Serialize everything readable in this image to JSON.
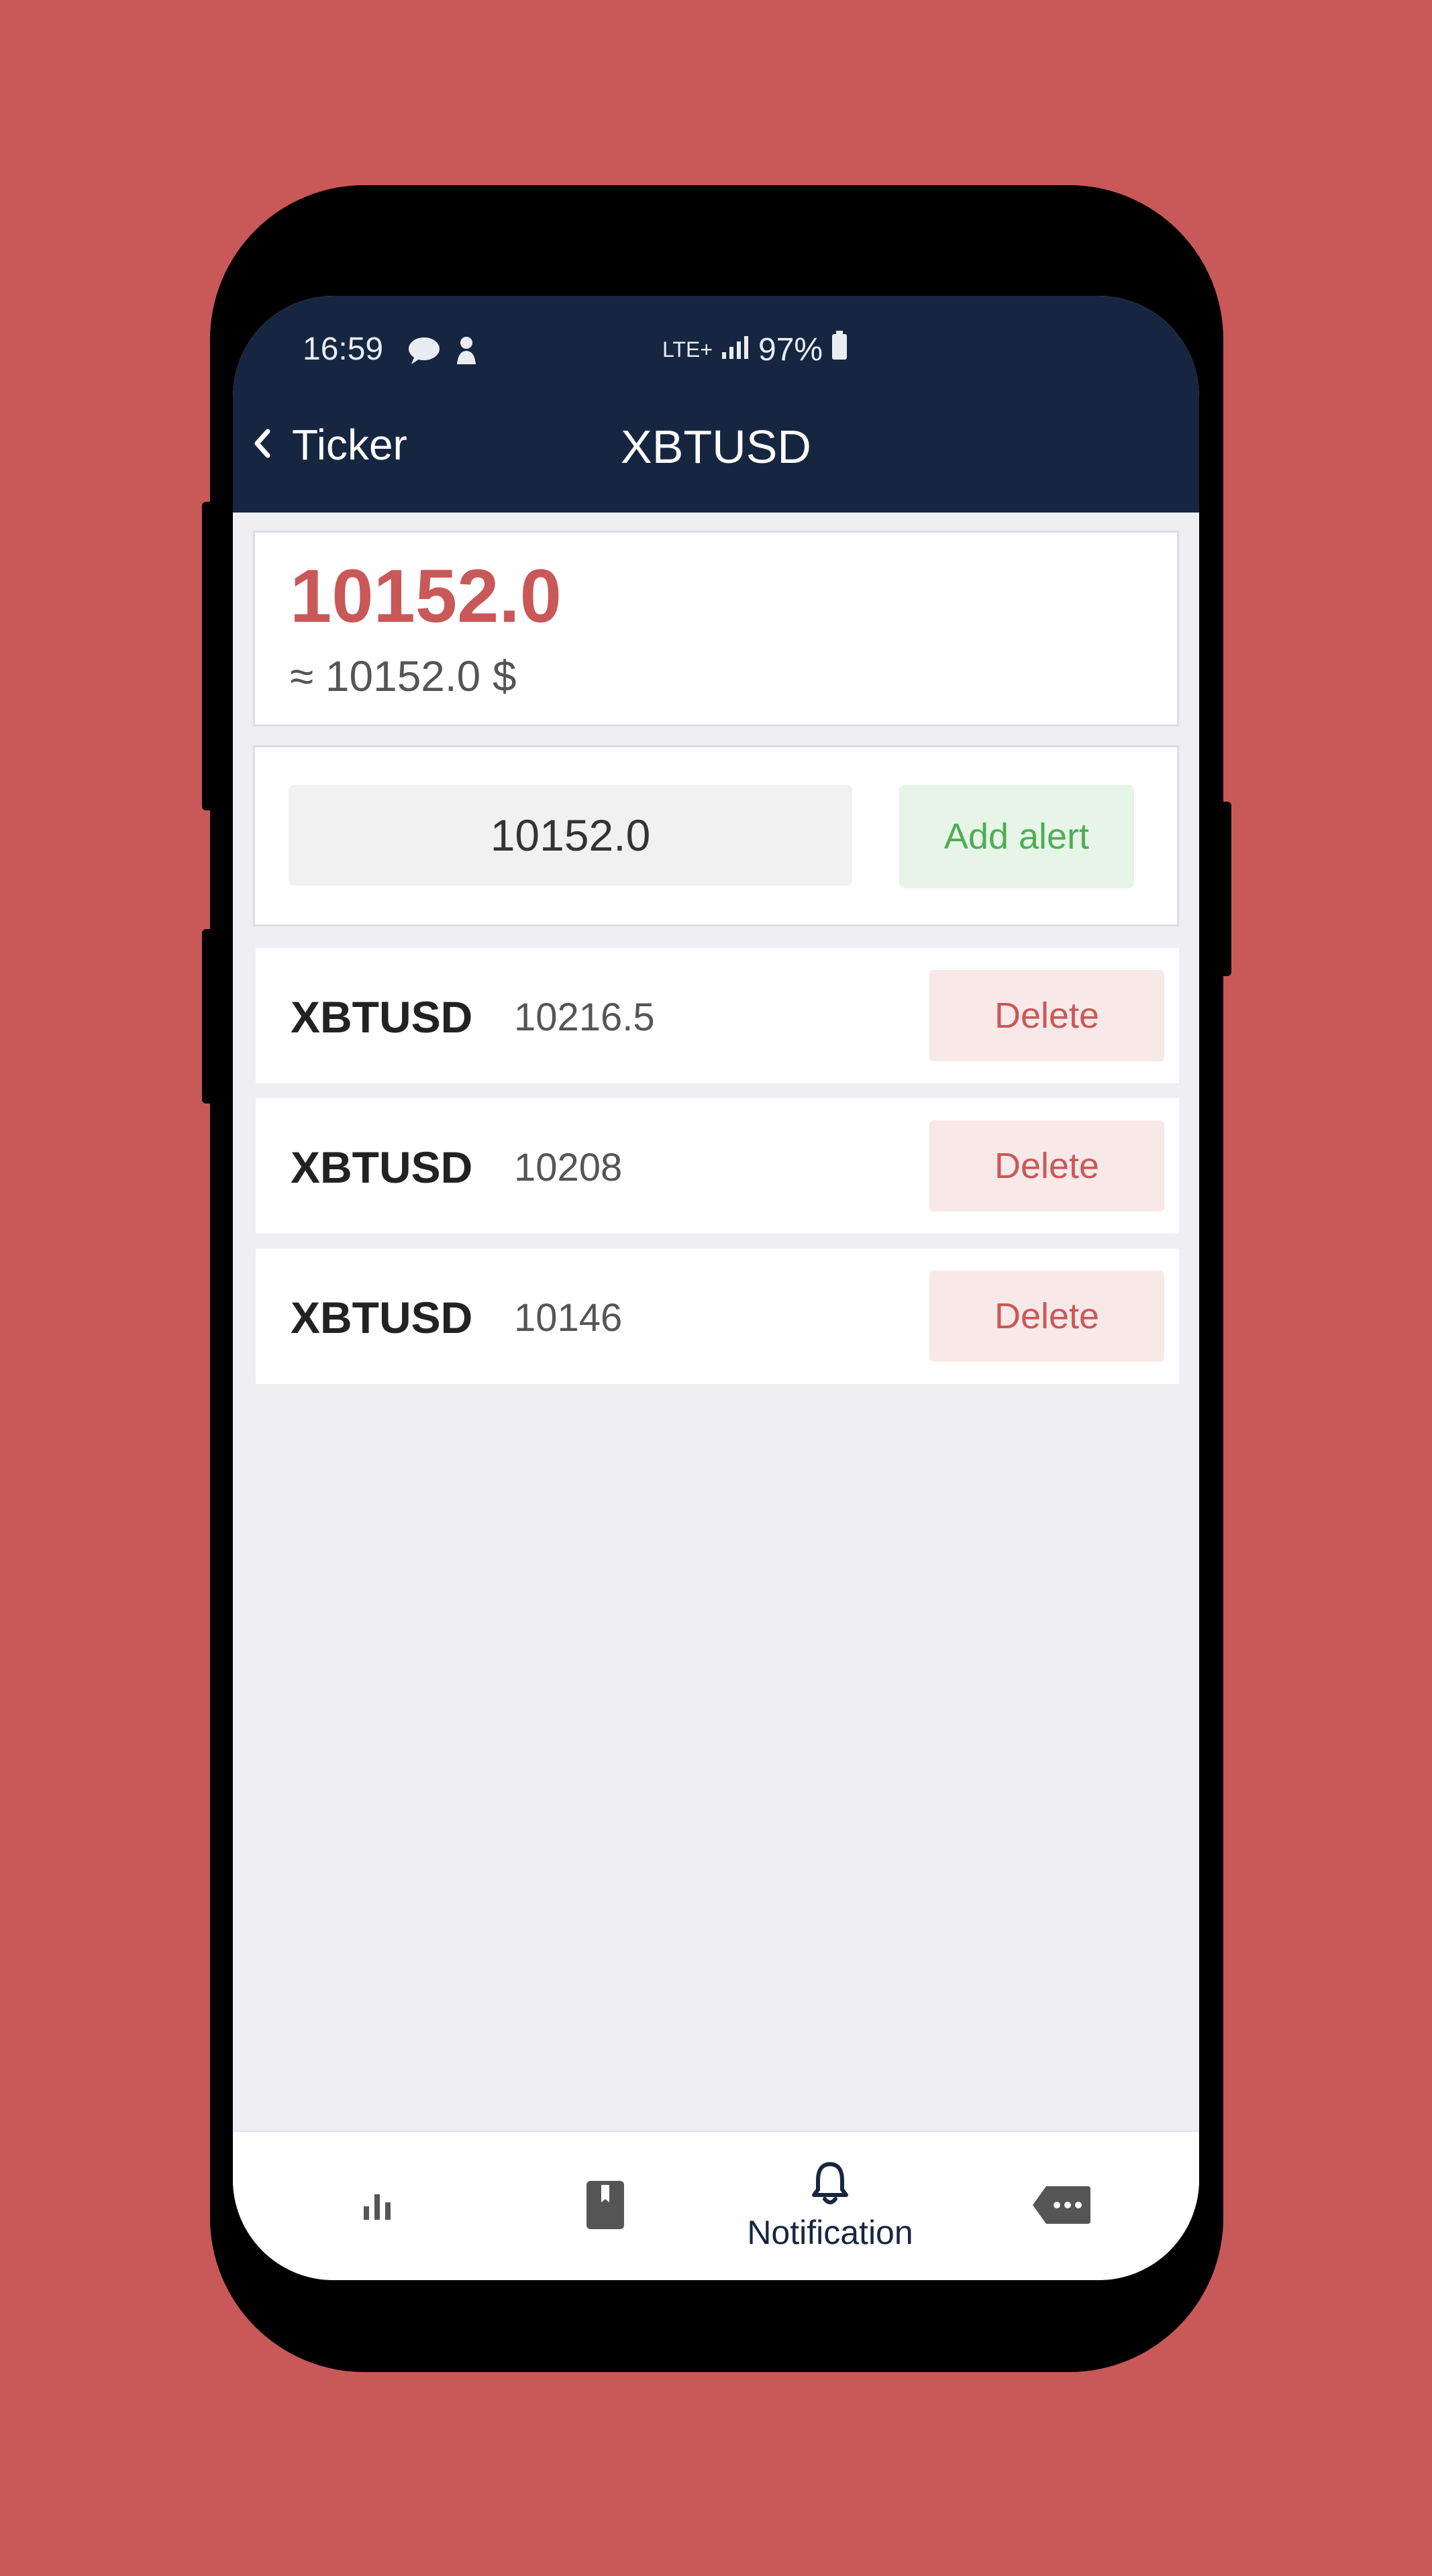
{
  "status_bar": {
    "time": "16:59",
    "network": "LTE+",
    "battery": "97%"
  },
  "header": {
    "back_label": "Ticker",
    "title": "XBTUSD"
  },
  "price_card": {
    "price": "10152.0",
    "approx": "≈ 10152.0 $"
  },
  "alert_form": {
    "input_value": "10152.0",
    "add_button": "Add alert"
  },
  "alerts": [
    {
      "symbol": "XBTUSD",
      "value": "10216.5",
      "delete_label": "Delete"
    },
    {
      "symbol": "XBTUSD",
      "value": "10208",
      "delete_label": "Delete"
    },
    {
      "symbol": "XBTUSD",
      "value": "10146",
      "delete_label": "Delete"
    }
  ],
  "tabbar": {
    "tabs": [
      {
        "icon": "bar-chart-icon",
        "label": ""
      },
      {
        "icon": "bookmark-icon",
        "label": ""
      },
      {
        "icon": "bell-icon",
        "label": "Notification"
      },
      {
        "icon": "message-more-icon",
        "label": ""
      }
    ]
  },
  "colors": {
    "background": "#c95858",
    "header": "#172640",
    "price_red": "#c95858",
    "add_green": "#4caf50"
  }
}
